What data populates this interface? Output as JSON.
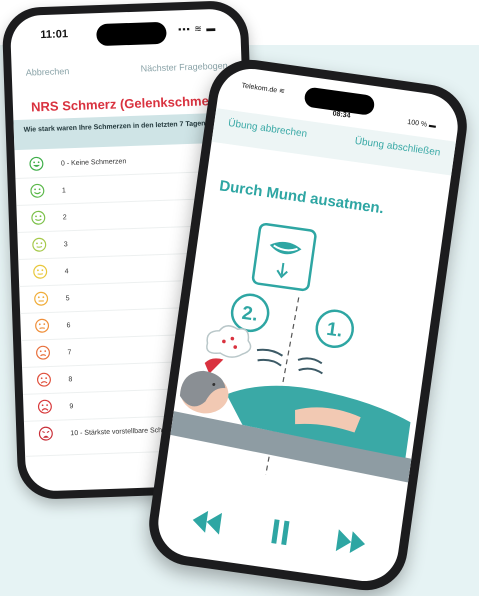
{
  "phone_left": {
    "status_bar": {
      "time": "11:01",
      "icons": "▪▪▪ ≋ ▬"
    },
    "nav": {
      "cancel_label": "Abbrechen",
      "next_label": "Nächster Fragebogen"
    },
    "title": "NRS Schmerz (Gelenkschmerz)",
    "question": "Wie stark waren Ihre Schmerzen in den letzten 7 Tagen?",
    "options": [
      {
        "label": "0 - Keine Schmerzen",
        "color": "#3fae49"
      },
      {
        "label": "1",
        "color": "#5bb84a"
      },
      {
        "label": "2",
        "color": "#7cc14a"
      },
      {
        "label": "3",
        "color": "#a6c94a"
      },
      {
        "label": "4",
        "color": "#e8c73c"
      },
      {
        "label": "5",
        "color": "#f0ad3a"
      },
      {
        "label": "6",
        "color": "#ef8f3a"
      },
      {
        "label": "7",
        "color": "#e8703c"
      },
      {
        "label": "8",
        "color": "#e0503c"
      },
      {
        "label": "9",
        "color": "#d8393b"
      },
      {
        "label": "10 - Stärkste vorstellbare Schmerzen",
        "color": "#c92f38"
      }
    ]
  },
  "phone_right": {
    "status_bar": {
      "carrier": "Telekom.de ≋",
      "time": "08:34",
      "battery": "100 % ▬"
    },
    "nav": {
      "cancel_label": "Übung abbrechen",
      "finish_label": "Übung abschließen"
    },
    "instruction": "Durch Mund ausatmen.",
    "steps": {
      "step2": "2.",
      "step1": "1."
    },
    "accent_color": "#2ea6a3",
    "icons": [
      "mouth-exhale-icon",
      "rewind-icon",
      "pause-icon",
      "fast-forward-icon"
    ]
  }
}
